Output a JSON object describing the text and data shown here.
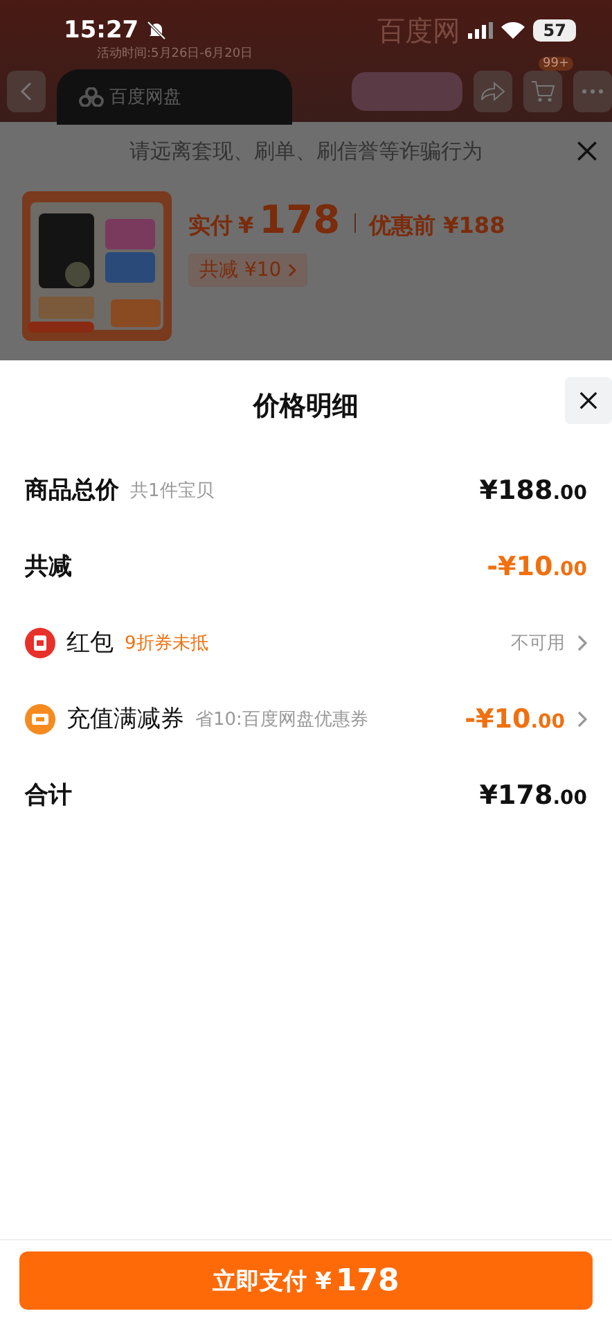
{
  "status_bar": {
    "time": "15:27",
    "battery": "57"
  },
  "background_page": {
    "brand": "百度网",
    "activity_time": "活动时间:5月26日-6月20日",
    "logo_text": "百度网盘",
    "cart_badge": "99+"
  },
  "order_sheet": {
    "warning": "请远离套现、刷单、刷信誉等诈骗行为",
    "paid_label": "实付",
    "paid_currency": "¥",
    "paid_amount": "178",
    "original_price": "优惠前 ¥188",
    "discount_chip": "共减 ¥10"
  },
  "price_detail": {
    "title": "价格明细",
    "rows": [
      {
        "kind": "plain",
        "label": "商品总价",
        "note": "共1件宝贝",
        "amount": "¥188",
        "fraction": ".00",
        "amount_highlighted": false
      },
      {
        "kind": "plain",
        "label": "共减",
        "amount": "-¥10",
        "fraction": ".00",
        "amount_highlighted": true
      },
      {
        "kind": "packet",
        "label": "红包",
        "note": "9折券未抵",
        "note_highlighted": true,
        "status": "不可用"
      },
      {
        "kind": "voucher",
        "label": "充值满减券",
        "note": "省10:百度网盘优惠券",
        "note_highlighted": false,
        "amount": "-¥10",
        "fraction": ".00",
        "amount_highlighted": true
      },
      {
        "kind": "plain",
        "label": "合计",
        "amount": "¥178",
        "fraction": ".00",
        "amount_highlighted": false
      }
    ],
    "pay_button": {
      "label": "立即支付",
      "currency": "¥",
      "amount": "178"
    }
  }
}
